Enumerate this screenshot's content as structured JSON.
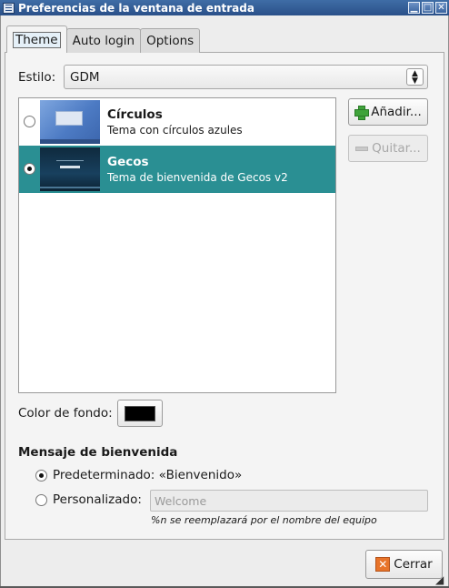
{
  "window": {
    "title": "Preferencias de la ventana de entrada",
    "minimize": "▁",
    "maximize": "□",
    "close": "✕"
  },
  "tabs": [
    {
      "label": "Theme",
      "active": true
    },
    {
      "label": "Auto login",
      "active": false
    },
    {
      "label": "Options",
      "active": false
    }
  ],
  "style": {
    "label": "Estilo:",
    "selected": "GDM"
  },
  "themes": [
    {
      "title": "Círculos",
      "description": "Tema con círculos azules",
      "selected": false
    },
    {
      "title": "Gecos",
      "description": "Tema de bienvenida de Gecos v2",
      "selected": true
    }
  ],
  "buttons": {
    "add": "Añadir...",
    "remove": "Quitar...",
    "close": "Cerrar"
  },
  "background_color": {
    "label": "Color de fondo:",
    "value": "#000000"
  },
  "welcome": {
    "title": "Mensaje de bienvenida",
    "default_option": "Predeterminado: «Bienvenido»",
    "custom_option": "Personalizado:",
    "custom_placeholder": "Welcome",
    "hint": "%n se reemplazará por el nombre del equipo",
    "selected": "default"
  },
  "icons": {
    "window_menu": "window-menu-icon",
    "add": "plus-icon",
    "remove": "minus-icon",
    "close": "close-icon",
    "resize": "resize-grip-icon"
  }
}
